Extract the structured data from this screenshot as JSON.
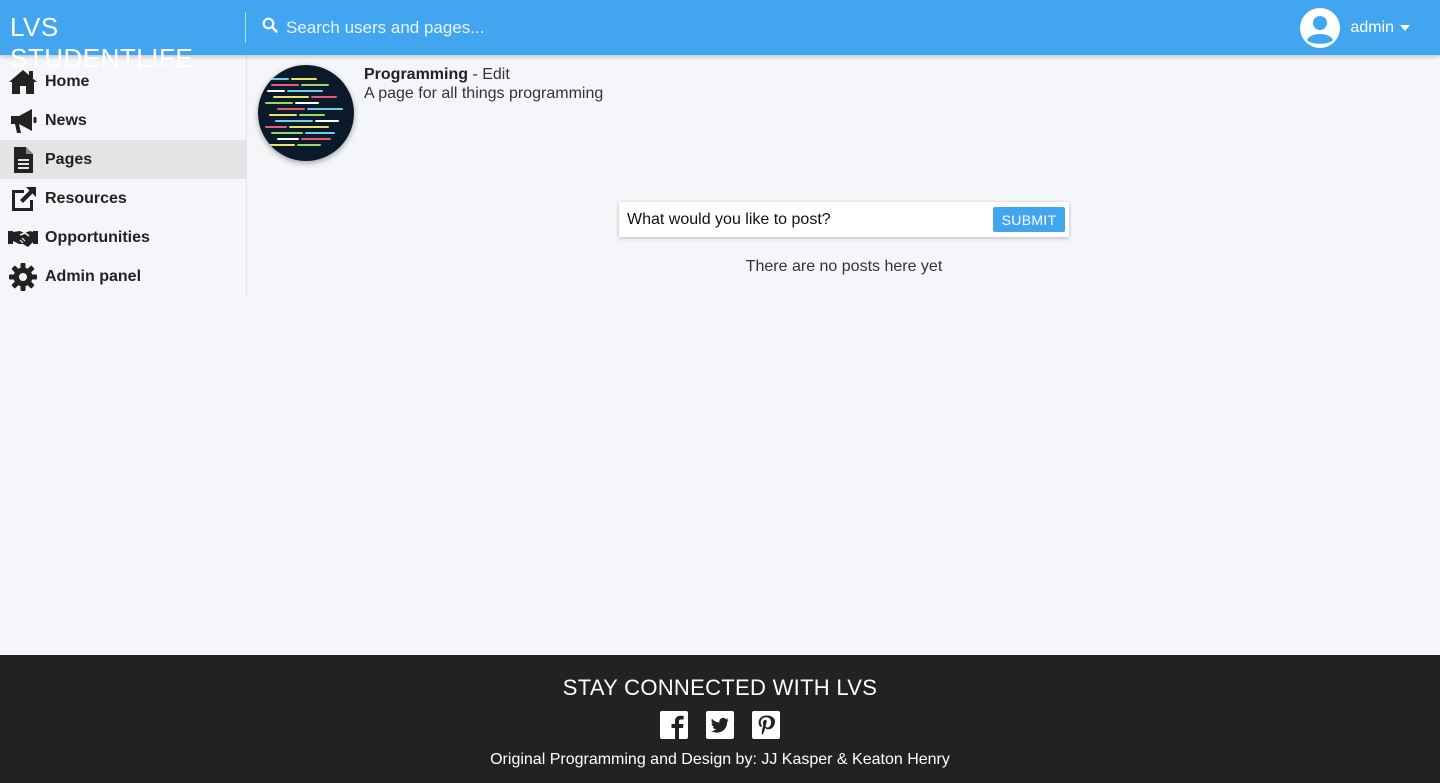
{
  "header": {
    "brand": "LVS STUDENTLIFE",
    "search_placeholder": "Search users and pages...",
    "search_icon": "search-icon",
    "user_name": "admin",
    "user_icon": "user-circle-icon",
    "caret_icon": "caret-down-icon",
    "color": "#42a5f0"
  },
  "sidebar": {
    "items": [
      {
        "label": "Home",
        "icon": "home-icon",
        "active": false
      },
      {
        "label": "News",
        "icon": "megaphone-icon",
        "active": false
      },
      {
        "label": "Pages",
        "icon": "document-icon",
        "active": true
      },
      {
        "label": "Resources",
        "icon": "external-edit-icon",
        "active": false
      },
      {
        "label": "Opportunities",
        "icon": "handshake-icon",
        "active": false
      },
      {
        "label": "Admin panel",
        "icon": "gear-icon",
        "active": false
      }
    ]
  },
  "page": {
    "title": "Programming",
    "separator": " - ",
    "edit_label": "Edit",
    "description": "A page for all things programming",
    "image_icon": "code-screen-image"
  },
  "composer": {
    "placeholder": "What would you like to post?",
    "submit_label": "SUBMIT"
  },
  "feed": {
    "empty_message": "There are no posts here yet"
  },
  "footer": {
    "heading": "STAY CONNECTED WITH LVS",
    "social": [
      "facebook-icon",
      "twitter-icon",
      "pinterest-icon"
    ],
    "credit": "Original Programming and Design by: JJ Kasper & Keaton Henry"
  }
}
